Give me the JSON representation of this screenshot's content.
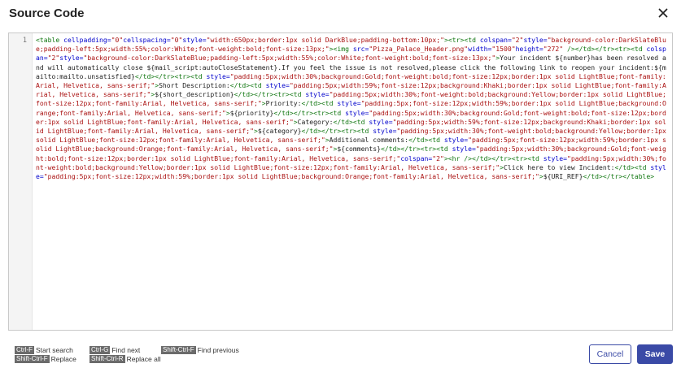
{
  "dialog": {
    "title": "Source Code",
    "close_icon": "close-icon"
  },
  "editor": {
    "line_number": "1",
    "code_segments": [
      {
        "c": "t",
        "s": "<table "
      },
      {
        "c": "a",
        "s": "cellpadding="
      },
      {
        "c": "v",
        "s": "\"0\""
      },
      {
        "c": "a",
        "s": "cellspacing="
      },
      {
        "c": "v",
        "s": "\"0\""
      },
      {
        "c": "a",
        "s": "style="
      },
      {
        "c": "v",
        "s": "\"width:650px;border:1px solid DarkBlue;padding-bottom:10px;\""
      },
      {
        "c": "t",
        "s": "><tr><td "
      },
      {
        "c": "a",
        "s": "colspan="
      },
      {
        "c": "v",
        "s": "\"2\""
      },
      {
        "c": "a",
        "s": "style="
      },
      {
        "c": "v",
        "s": "\"background-color:DarkSlateBlue;padding-left:5px;width:55%;color:White;font-weight:bold;font-size:13px;\""
      },
      {
        "c": "t",
        "s": "><img "
      },
      {
        "c": "a",
        "s": "src="
      },
      {
        "c": "v",
        "s": "\"Pizza_Palace_Header.png\""
      },
      {
        "c": "a",
        "s": "width="
      },
      {
        "c": "v",
        "s": "\"1500\""
      },
      {
        "c": "a",
        "s": "height="
      },
      {
        "c": "v",
        "s": "\"272\""
      },
      {
        "c": "t",
        "s": " /></td></tr><tr><td "
      },
      {
        "c": "a",
        "s": "colspan="
      },
      {
        "c": "v",
        "s": "\"2\""
      },
      {
        "c": "a",
        "s": "style="
      },
      {
        "c": "v",
        "s": "\"background-color:DarkSlateBlue;padding-left:5px;width:55%;color:White;font-weight:bold;font-size:13px;\""
      },
      {
        "c": "t",
        "s": ">"
      },
      {
        "c": "p",
        "s": "Your incident ${number}has been resolved and will automatically close ${mail_script:autoCloseStatement}.If you feel the issue is not resolved,please click the following link to reopen your incident:${mailto:mailto.unsatisfied}"
      },
      {
        "c": "t",
        "s": "</td></tr><tr><td "
      },
      {
        "c": "a",
        "s": "style="
      },
      {
        "c": "v",
        "s": "\"padding:5px;width:30%;background:Gold;font-weight:bold;font-size:12px;border:1px solid LightBlue;font-family:Arial, Helvetica, sans-serif;\""
      },
      {
        "c": "t",
        "s": ">"
      },
      {
        "c": "p",
        "s": "Short Description:"
      },
      {
        "c": "t",
        "s": "</td><td "
      },
      {
        "c": "a",
        "s": "style="
      },
      {
        "c": "v",
        "s": "\"padding:5px;width:59%;font-size:12px;background:Khaki;border:1px solid LightBlue;font-family:Arial, Helvetica, sans-serif;\""
      },
      {
        "c": "t",
        "s": ">"
      },
      {
        "c": "p",
        "s": "${short_description}"
      },
      {
        "c": "t",
        "s": "</td></tr><tr><td "
      },
      {
        "c": "a",
        "s": "style="
      },
      {
        "c": "v",
        "s": "\"padding:5px;width:30%;font-weight:bold;background:Yellow;border:1px solid LightBlue;font-size:12px;font-family:Arial, Helvetica, sans-serif;\""
      },
      {
        "c": "t",
        "s": ">"
      },
      {
        "c": "p",
        "s": "Priority:"
      },
      {
        "c": "t",
        "s": "</td><td "
      },
      {
        "c": "a",
        "s": "style="
      },
      {
        "c": "v",
        "s": "\"padding:5px;font-size:12px;width:59%;border:1px solid LightBlue;background:Orange;font-family:Arial, Helvetica, sans-serif;\""
      },
      {
        "c": "t",
        "s": ">"
      },
      {
        "c": "p",
        "s": "${priority}"
      },
      {
        "c": "t",
        "s": "</td></tr><tr><td "
      },
      {
        "c": "a",
        "s": "style="
      },
      {
        "c": "v",
        "s": "\"padding:5px;width:30%;background:Gold;font-weight:bold;font-size:12px;border:1px solid LightBlue;font-family:Arial, Helvetica, sans-serif;\""
      },
      {
        "c": "t",
        "s": ">"
      },
      {
        "c": "p",
        "s": "Category:"
      },
      {
        "c": "t",
        "s": "</td><td "
      },
      {
        "c": "a",
        "s": "style="
      },
      {
        "c": "v",
        "s": "\"padding:5px;width:59%;font-size:12px;background:Khaki;border:1px solid LightBlue;font-family:Arial, Helvetica, sans-serif;\""
      },
      {
        "c": "t",
        "s": ">"
      },
      {
        "c": "p",
        "s": "${category}"
      },
      {
        "c": "t",
        "s": "</td></tr><tr><td "
      },
      {
        "c": "a",
        "s": "style="
      },
      {
        "c": "v",
        "s": "\"padding:5px;width:30%;font-weight:bold;background:Yellow;border:1px solid LightBlue;font-size:12px;font-family:Arial, Helvetica, sans-serif;\""
      },
      {
        "c": "t",
        "s": ">"
      },
      {
        "c": "p",
        "s": "Additional comments:"
      },
      {
        "c": "t",
        "s": "</td><td "
      },
      {
        "c": "a",
        "s": "style="
      },
      {
        "c": "v",
        "s": "\"padding:5px;font-size:12px;width:59%;border:1px solid LightBlue;background:Orange;font-family:Arial, Helvetica, sans-serif;\""
      },
      {
        "c": "t",
        "s": ">"
      },
      {
        "c": "p",
        "s": "${comments}"
      },
      {
        "c": "t",
        "s": "</td></tr><tr><td "
      },
      {
        "c": "a",
        "s": "style="
      },
      {
        "c": "v",
        "s": "\"padding:5px;width:30%;background:Gold;font-weight:bold;font-size:12px;border:1px solid LightBlue;font-family:Arial, Helvetica, sans-serif;\""
      },
      {
        "c": "a",
        "s": "colspan="
      },
      {
        "c": "v",
        "s": "\"2\""
      },
      {
        "c": "t",
        "s": "><hr /></td></tr><tr><td "
      },
      {
        "c": "a",
        "s": "style="
      },
      {
        "c": "v",
        "s": "\"padding:5px;width:30%;font-weight:bold;background:Yellow;border:1px solid LightBlue;font-size:12px;font-family:Arial, Helvetica, sans-serif;\""
      },
      {
        "c": "t",
        "s": ">"
      },
      {
        "c": "p",
        "s": "Click here to view Incident:"
      },
      {
        "c": "t",
        "s": "</td><td "
      },
      {
        "c": "a",
        "s": "style="
      },
      {
        "c": "v",
        "s": "\"padding:5px;font-size:12px;width:59%;border:1px solid LightBlue;background:Orange;font-family:Arial, Helvetica, sans-serif;\""
      },
      {
        "c": "t",
        "s": ">"
      },
      {
        "c": "p",
        "s": "${URI_REF}"
      },
      {
        "c": "t",
        "s": "</td></tr></table>"
      }
    ]
  },
  "shortcuts": [
    {
      "key": "Ctrl-F",
      "label": "Start search"
    },
    {
      "key": "Ctrl-G",
      "label": "Find next"
    },
    {
      "key": "Shift-Ctrl-F",
      "label": "Find previous"
    },
    {
      "key": "Shift-Ctrl-F",
      "label": "Replace"
    },
    {
      "key": "Shift-Ctrl-R",
      "label": "Replace all"
    }
  ],
  "buttons": {
    "cancel": "Cancel",
    "save": "Save"
  },
  "colors": {
    "primary": "#3a4aa6",
    "tag": "#117711",
    "attr": "#0000cc",
    "value": "#aa1111"
  }
}
